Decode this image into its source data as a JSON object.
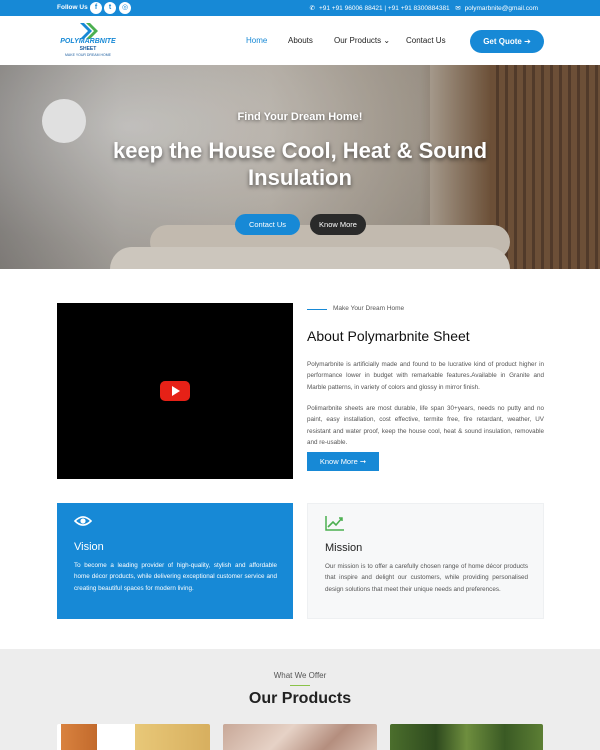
{
  "topbar": {
    "follow_label": "Follow Us :",
    "social": [
      {
        "label": "f",
        "icon": "facebook-icon"
      },
      {
        "label": "t",
        "icon": "twitter-icon"
      },
      {
        "label": "◎",
        "icon": "instagram-icon"
      }
    ],
    "phone": "+91 +91 96006 88421 | +91 +91 8300884381",
    "email": "polymarbnite@gmail.com"
  },
  "logo": {
    "line1": "POLYMARBNITE",
    "line2": "SHEET",
    "line3": "MAKE YOUR DREAM HOME"
  },
  "nav": {
    "items": [
      "Home",
      "Abouts",
      "Our Products ⌄",
      "Contact Us"
    ],
    "active": "Home",
    "cta": "Get Quote ➔"
  },
  "hero": {
    "tagline": "Find Your Dream Home!",
    "title": "keep the House Cool, Heat & Sound Insulation",
    "btn_contact": "Contact Us",
    "btn_know": "Know More"
  },
  "about": {
    "subtitle": "Make Your Dream Home",
    "title": "About Polymarbnite Sheet",
    "p1": "Polymarbnite is artificially made and found to be lucrative kind of product higher in performance lower in budget with remarkable features.Available in Granite and Marble patterns, in variety of colors and glossy in mirror finish.",
    "p2": "Polimarbnite sheets are most durable, life span 30+years, needs no putty and no paint, easy installation, cost effective, termite free, fire retardant, weather, UV resistant and water proof, keep the house cool, heat & sound insulation, removable and re-usable.",
    "btn": "Know More ➞"
  },
  "vision": {
    "title": "Vision",
    "text": "To become a leading provider of high-quality, stylish and affordable home décor products, while delivering exceptional customer service and creating beautiful spaces for modern living."
  },
  "mission": {
    "title": "Mission",
    "text": "Our mission is to offer a carefully chosen range of home décor products that inspire and delight our customers, while providing personalised design solutions that meet their unique needs and preferences."
  },
  "products": {
    "subtitle": "What We Offer",
    "title": "Our Products"
  },
  "colors": {
    "primary": "#1789d6",
    "dark": "#2a2a2a",
    "accent_green": "#4caf50"
  }
}
